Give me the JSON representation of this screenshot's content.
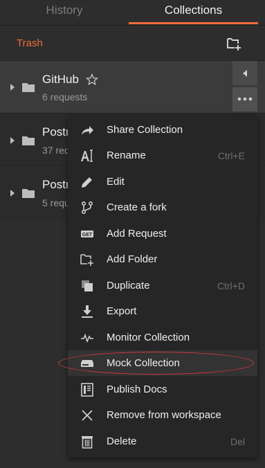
{
  "tabs": {
    "history": "History",
    "collections": "Collections"
  },
  "toolbar": {
    "trash": "Trash",
    "new_collection_icon": "new-collection-icon"
  },
  "collections": [
    {
      "name": "GitHub",
      "count": "6 requests"
    },
    {
      "name": "Postm",
      "count": "37 req"
    },
    {
      "name": "Postm",
      "count": "5 requ"
    }
  ],
  "menu": {
    "share": "Share Collection",
    "rename": "Rename",
    "rename_shortcut": "Ctrl+E",
    "edit": "Edit",
    "fork": "Create a fork",
    "add_request": "Add Request",
    "add_folder": "Add Folder",
    "duplicate": "Duplicate",
    "duplicate_shortcut": "Ctrl+D",
    "export": "Export",
    "monitor": "Monitor Collection",
    "mock": "Mock Collection",
    "publish": "Publish Docs",
    "remove": "Remove from workspace",
    "delete": "Delete",
    "delete_shortcut": "Del"
  },
  "colors": {
    "accent": "#f26b3a",
    "annotation": "#d6373f"
  }
}
